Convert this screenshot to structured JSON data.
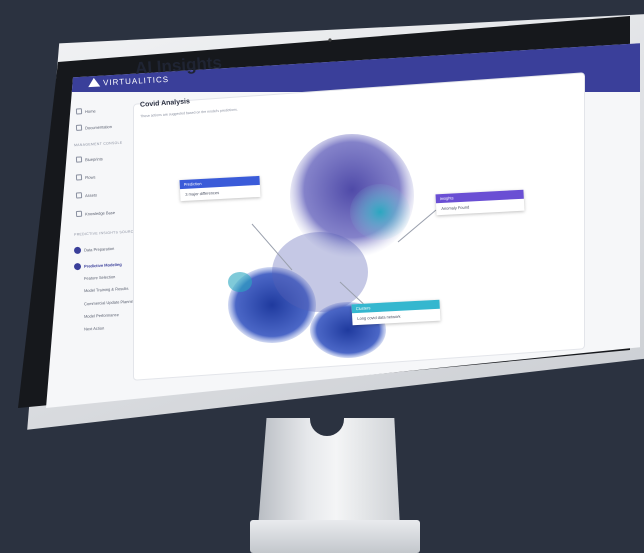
{
  "app": {
    "brand": "VIRTUALITICS",
    "accent": "#3a3f9a"
  },
  "topbar": {
    "icons": [
      "toggle-icon",
      "user-icon",
      "alert-icon",
      "gear-icon",
      "menu-icon"
    ]
  },
  "sidebar": {
    "items": [
      {
        "label": "Home",
        "icon": "home-icon"
      },
      {
        "label": "Documentation",
        "icon": "doc-icon"
      },
      {
        "label": "MANAGEMENT CONSOLE",
        "section": true
      },
      {
        "label": "Blueprints",
        "icon": "blueprint-icon"
      },
      {
        "label": "Flows",
        "icon": "flow-icon"
      },
      {
        "label": "Assets",
        "icon": "asset-icon"
      },
      {
        "label": "Knowledge Base",
        "icon": "kb-icon"
      },
      {
        "label": "PREDICTIVE INSIGHTS SOURCES",
        "section": true
      },
      {
        "label": "Data Preparation",
        "icon": "dot"
      },
      {
        "label": "Predictive Modeling",
        "icon": "dot",
        "active": true
      },
      {
        "label": "Feature Selection",
        "icon": "sub"
      },
      {
        "label": "Model Training & Results",
        "icon": "sub"
      },
      {
        "label": "Commercial Update Planning",
        "icon": "sub"
      },
      {
        "label": "Model Performance",
        "icon": "sub"
      },
      {
        "label": "Next Action",
        "icon": "sub"
      }
    ]
  },
  "main": {
    "title": "AI Insights",
    "card_title": "Covid Analysis",
    "card_subtitle": "These actions are suggested based on the model's predictions."
  },
  "callouts": [
    {
      "header": "Prediction",
      "body": "3 major differences",
      "color": "#3a5bd9"
    },
    {
      "header": "Insights",
      "body": "Anomaly Found",
      "color": "#6a4fd4"
    },
    {
      "header": "Clusters",
      "body": "Long covid data network",
      "color": "#35b7cf"
    }
  ]
}
